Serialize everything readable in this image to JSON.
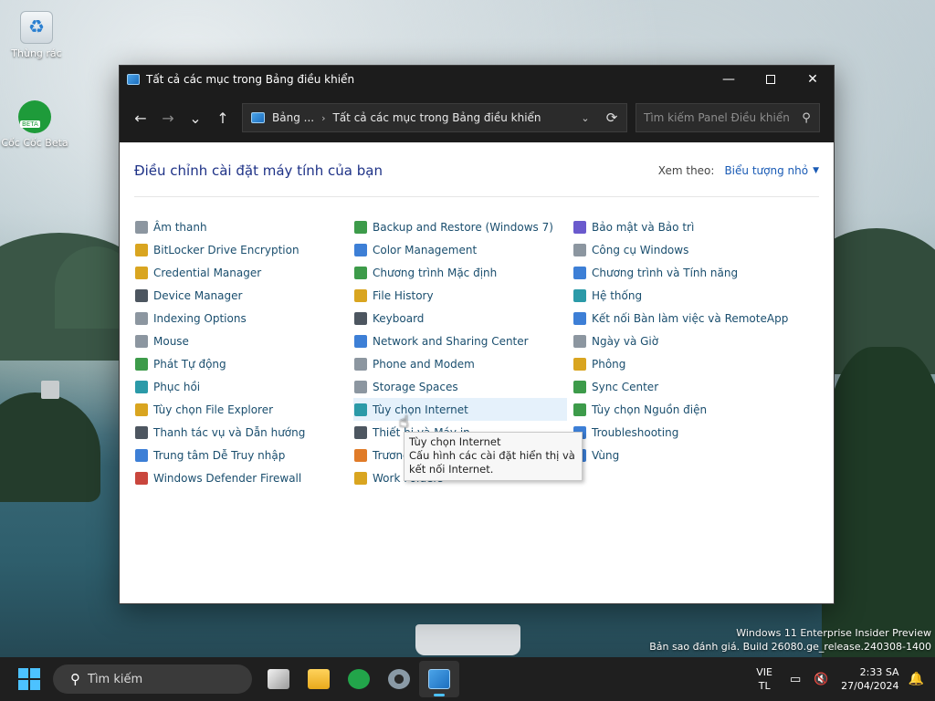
{
  "desktop": {
    "icons": [
      {
        "label": "Thùng rác",
        "icon": "recycle-bin-icon"
      },
      {
        "label": "Cốc Cốc Beta",
        "icon": "coccoc-beta-icon"
      }
    ],
    "watermark": {
      "line1": "Windows 11 Enterprise Insider Preview",
      "line2": "Bản sao đánh giá. Build 26080.ge_release.240308-1400"
    }
  },
  "window": {
    "title": "Tất cả các mục trong Bảng điều khiển",
    "controls": {
      "minimize": "—",
      "maximize": "",
      "close": "✕"
    },
    "nav": {
      "back": "←",
      "forward": "→",
      "recent": "⌄",
      "up": "↑"
    },
    "address": {
      "crumbs": [
        "Bảng ...",
        "Tất cả các mục trong Bảng điều khiển"
      ],
      "separator": "›"
    },
    "search": {
      "placeholder": "Tìm kiếm Panel Điều khiển"
    },
    "heading": "Điều chỉnh cài đặt máy tính của bạn",
    "view_by": {
      "label": "Xem theo:",
      "value": "Biểu tượng nhỏ"
    },
    "columns": [
      [
        {
          "label": "Âm thanh",
          "icon": "sound-icon",
          "color": "c-grey"
        },
        {
          "label": "BitLocker Drive Encryption",
          "icon": "bitlocker-icon",
          "color": "c-yellow"
        },
        {
          "label": "Credential Manager",
          "icon": "credential-manager-icon",
          "color": "c-yellow"
        },
        {
          "label": "Device Manager",
          "icon": "device-manager-icon",
          "color": "c-dark"
        },
        {
          "label": "Indexing Options",
          "icon": "indexing-options-icon",
          "color": "c-grey"
        },
        {
          "label": "Mouse",
          "icon": "mouse-icon",
          "color": "c-grey"
        },
        {
          "label": "Phát Tự động",
          "icon": "autoplay-icon",
          "color": "c-green"
        },
        {
          "label": "Phục hồi",
          "icon": "recovery-icon",
          "color": "c-teal"
        },
        {
          "label": "Tùy chọn File Explorer",
          "icon": "file-explorer-options-icon",
          "color": "c-yellow"
        },
        {
          "label": "Thanh tác vụ và Dẫn hướng",
          "icon": "taskbar-navigation-icon",
          "color": "c-dark"
        },
        {
          "label": "Trung tâm Dễ Truy nhập",
          "icon": "ease-of-access-icon",
          "color": "c-blue"
        },
        {
          "label": "Windows Defender Firewall",
          "icon": "firewall-icon",
          "color": "c-red"
        }
      ],
      [
        {
          "label": "Backup and Restore (Windows 7)",
          "icon": "backup-restore-icon",
          "color": "c-green"
        },
        {
          "label": "Color Management",
          "icon": "color-management-icon",
          "color": "c-blue"
        },
        {
          "label": "Chương trình Mặc định",
          "icon": "default-programs-icon",
          "color": "c-green"
        },
        {
          "label": "File History",
          "icon": "file-history-icon",
          "color": "c-yellow"
        },
        {
          "label": "Keyboard",
          "icon": "keyboard-icon",
          "color": "c-dark"
        },
        {
          "label": "Network and Sharing Center",
          "icon": "network-sharing-icon",
          "color": "c-blue"
        },
        {
          "label": "Phone and Modem",
          "icon": "phone-modem-icon",
          "color": "c-grey"
        },
        {
          "label": "Storage Spaces",
          "icon": "storage-spaces-icon",
          "color": "c-grey"
        },
        {
          "label": "Tùy chọn Internet",
          "icon": "internet-options-icon",
          "color": "c-teal",
          "hover": true
        },
        {
          "label": "Thiết bị và Máy in",
          "icon": "devices-printers-icon",
          "color": "c-dark"
        },
        {
          "label": "Trương trình Nhận dạng Giọng nói",
          "icon": "speech-recognition-icon",
          "color": "c-orange"
        },
        {
          "label": "Work Folders",
          "icon": "work-folders-icon",
          "color": "c-yellow"
        }
      ],
      [
        {
          "label": "Bảo mật và Bảo trì",
          "icon": "security-maintenance-icon",
          "color": "c-purple"
        },
        {
          "label": "Công cụ Windows",
          "icon": "windows-tools-icon",
          "color": "c-grey"
        },
        {
          "label": "Chương trình và Tính năng",
          "icon": "programs-features-icon",
          "color": "c-blue"
        },
        {
          "label": "Hệ thống",
          "icon": "system-icon",
          "color": "c-teal"
        },
        {
          "label": "Kết nối Bàn làm việc và RemoteApp",
          "icon": "remoteapp-icon",
          "color": "c-blue"
        },
        {
          "label": "Ngày và Giờ",
          "icon": "date-time-icon",
          "color": "c-grey"
        },
        {
          "label": "Phông",
          "icon": "fonts-icon",
          "color": "c-yellow"
        },
        {
          "label": "Sync Center",
          "icon": "sync-center-icon",
          "color": "c-green"
        },
        {
          "label": "Tùy chọn Nguồn điện",
          "icon": "power-options-icon",
          "color": "c-green"
        },
        {
          "label": "Troubleshooting",
          "icon": "troubleshooting-icon",
          "color": "c-blue"
        },
        {
          "label": "Vùng",
          "icon": "region-icon",
          "color": "c-blue"
        }
      ]
    ],
    "tooltip": {
      "title": "Tùy chọn Internet",
      "description": "Cấu hình các cài đặt hiển thị và kết nối Internet."
    }
  },
  "taskbar": {
    "search_placeholder": "Tìm kiếm",
    "apps": [
      {
        "name": "task-view",
        "icon": "task-view-icon"
      },
      {
        "name": "file-explorer",
        "icon": "file-explorer-icon"
      },
      {
        "name": "coccoc",
        "icon": "coccoc-icon"
      },
      {
        "name": "settings",
        "icon": "settings-icon"
      },
      {
        "name": "control-panel",
        "icon": "control-panel-icon",
        "active": true
      }
    ],
    "language": {
      "line1": "VIE",
      "line2": "TL"
    },
    "clock": {
      "time": "2:33 SA",
      "date": "27/04/2024"
    }
  }
}
